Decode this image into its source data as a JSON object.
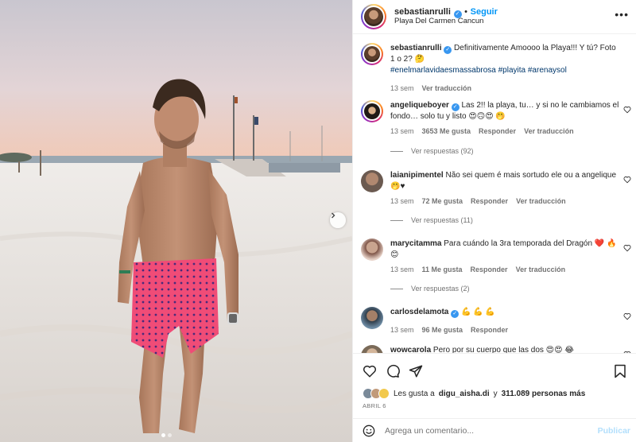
{
  "post": {
    "username": "sebastianrulli",
    "follow_label": "Seguir",
    "location": "Playa Del Carmen Cancun",
    "more_label": "•••"
  },
  "caption": {
    "username": "sebastianrulli",
    "text": "Definitivamente Amoooo la Playa!!! Y tú? Foto 1 o 2? 🤔",
    "hashtags": "#enelmarlavidaesmassabrosa #playita #arenaysol",
    "time": "13 sem",
    "translate": "Ver traducción"
  },
  "comments": [
    {
      "username": "angeliqueboyer",
      "verified": true,
      "text": "Las 2!! la playa, tu… y si no le cambiamos el fondo… solo tu y listo 😍🙃😍 🤭",
      "time": "13 sem",
      "likes": "3653 Me gusta",
      "reply": "Responder",
      "translate": "Ver traducción",
      "replies": "Ver respuestas (92)"
    },
    {
      "username": "laianipimentel",
      "verified": false,
      "text": "Não sei quem é mais sortudo ele ou a angelique 🤭♥",
      "time": "13 sem",
      "likes": "72 Me gusta",
      "reply": "Responder",
      "translate": "Ver traducción",
      "replies": "Ver respuestas (11)"
    },
    {
      "username": "marycitamma",
      "verified": false,
      "text": "Para cuándo la 3ra temporada del Dragón ❤️ 🔥 😊",
      "time": "13 sem",
      "likes": "11 Me gusta",
      "reply": "Responder",
      "translate": "Ver traducción",
      "replies": "Ver respuestas (2)"
    },
    {
      "username": "carlosdelamota",
      "verified": true,
      "text": "💪 💪 💪",
      "time": "13 sem",
      "likes": "96 Me gusta",
      "reply": "Responder"
    },
    {
      "username": "wowcarola",
      "verified": false,
      "text": "Pero por su cuerpo que las dos 😍😍 😂"
    }
  ],
  "likes": {
    "prefix": "Les gusta a",
    "first_user": "digu_aisha.di",
    "connector": "y",
    "others": "311.089 personas más"
  },
  "date": "ABRIL 6",
  "add_comment": {
    "placeholder": "Agrega un comentario...",
    "publish": "Publicar"
  },
  "icons": {
    "like": "heart-icon",
    "comment": "comment-icon",
    "share": "share-icon",
    "save": "bookmark-icon",
    "emoji": "emoji-icon",
    "more": "more-icon",
    "next": "chevron-right-icon"
  },
  "colors": {
    "accent": "#0095f6",
    "verified": "#3897f0",
    "muted": "#737373",
    "hashtag": "#00376b",
    "publish_disabled": "#b2dffc"
  }
}
